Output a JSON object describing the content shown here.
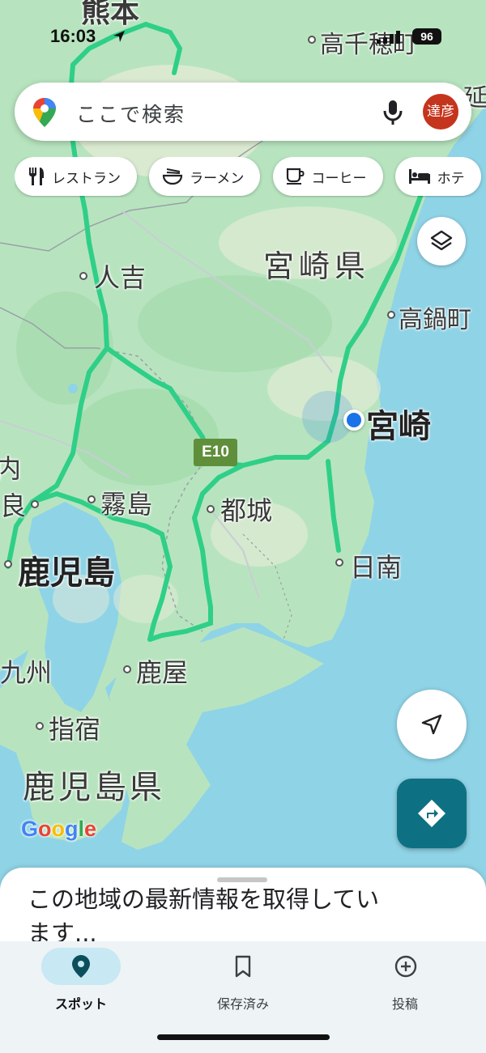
{
  "status_bar": {
    "time": "16:03",
    "battery": "96",
    "location_icon": "location-arrow-icon"
  },
  "search": {
    "placeholder": "ここで検索",
    "avatar_text": "達彦",
    "brand_color": "#c5341c"
  },
  "chips": [
    {
      "label": "レストラン",
      "icon": "restaurant-icon"
    },
    {
      "label": "ラーメン",
      "icon": "ramen-icon"
    },
    {
      "label": "コーヒー",
      "icon": "coffee-icon"
    },
    {
      "label": "ホテ",
      "icon": "hotel-icon"
    }
  ],
  "map": {
    "labels": {
      "kumamoto": "熊本",
      "takachiho": "高千穂町",
      "nobeoka": "延",
      "miyazaki_pref": "宮崎県",
      "hitoyoshi": "人吉",
      "takanabe": "高鍋町",
      "miyazaki": "宮崎",
      "sendai_partial": "内",
      "aira_partial": "良",
      "kirishima": "霧島",
      "miyakonojo": "都城",
      "kagoshima": "鹿児島",
      "nichinan": "日南",
      "kyushu_partial": "九州",
      "kanoya": "鹿屋",
      "ibusuki": "指宿",
      "kagoshima_pref": "鹿児島県"
    },
    "highway_shield": "E10",
    "google_logo": "Google",
    "colors": {
      "land": "#b7e4bf",
      "sea": "#8fd3e6",
      "road": "#2fcf88",
      "highway_shield": "#5f8f3a",
      "my_location": "#1a73e8"
    }
  },
  "sheet": {
    "message": "この地域の最新情報を取得しています..."
  },
  "bottom_nav": [
    {
      "label": "スポット",
      "icon": "place-pin-icon",
      "active": true
    },
    {
      "label": "保存済み",
      "icon": "bookmark-icon",
      "active": false
    },
    {
      "label": "投稿",
      "icon": "add-circle-icon",
      "active": false
    }
  ],
  "accent_color": "#0e7083"
}
